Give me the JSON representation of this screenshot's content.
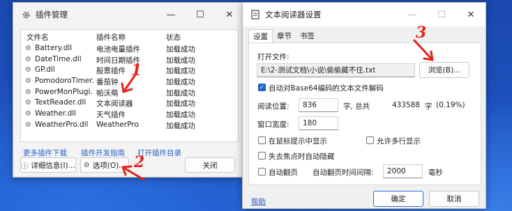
{
  "plugin_manager": {
    "title": "插件管理",
    "columns": [
      "文件名",
      "插件名称",
      "状态"
    ],
    "rows": [
      {
        "file": "Battery.dll",
        "name": "电池电量插件",
        "status": "加载成功"
      },
      {
        "file": "DateTime.dll",
        "name": "时间日期插件",
        "status": "加载成功"
      },
      {
        "file": "GP.dll",
        "name": "股票插件",
        "status": "加载成功"
      },
      {
        "file": "PomodoroTimer....",
        "name": "番茄钟",
        "status": "加载成功"
      },
      {
        "file": "PowerMonPlugi...",
        "name": "帕沃萌",
        "status": "加载成功"
      },
      {
        "file": "TextReader.dll",
        "name": "文本阅读器",
        "status": "加载成功"
      },
      {
        "file": "Weather.dll",
        "name": "天气插件",
        "status": "加载成功"
      },
      {
        "file": "WeatherPro.dll",
        "name": "WeatherPro",
        "status": "加载成功"
      }
    ],
    "links": {
      "download": "更多插件下载",
      "dev_guide": "插件开发指南",
      "open_dir": "打开插件目录"
    },
    "buttons": {
      "details": "详细信息(I)...",
      "options": "选项(O)...",
      "close": "关闭"
    }
  },
  "settings": {
    "title": "文本阅读器设置",
    "tabs": [
      "设置",
      "章节",
      "书签"
    ],
    "open_file_label": "打开文件:",
    "file_path": "E:\\2-测试文档\\小说\\偷偷藏不住.txt",
    "browse_button": "浏览(B)...",
    "base64_checkbox": "自动对Base64编码的文本文件解码",
    "base64_checked": true,
    "read_pos_label": "阅读位置:",
    "read_pos_value": "836",
    "char_total_label": "字, 总共",
    "total_chars": "433588",
    "char_unit": "字",
    "percent": "(0.19%)",
    "window_width_label": "窗口宽度:",
    "window_width_value": "180",
    "show_in_tooltip": "在鼠标提示中显示",
    "allow_multiline": "允许多行显示",
    "auto_hide": "失去焦点时自动隐藏",
    "auto_page": "自动翻页",
    "auto_page_interval_label": "自动翻页时间间隔:",
    "auto_page_interval": "2000",
    "ms_unit": "毫秒",
    "help_link": "帮助",
    "ok_button": "确定",
    "cancel_button": "取消"
  },
  "annotations": [
    "1",
    "2",
    "3"
  ],
  "colors": {
    "annotation": "#e8201a",
    "link": "#2a60c8",
    "accent": "#1a66c9"
  }
}
